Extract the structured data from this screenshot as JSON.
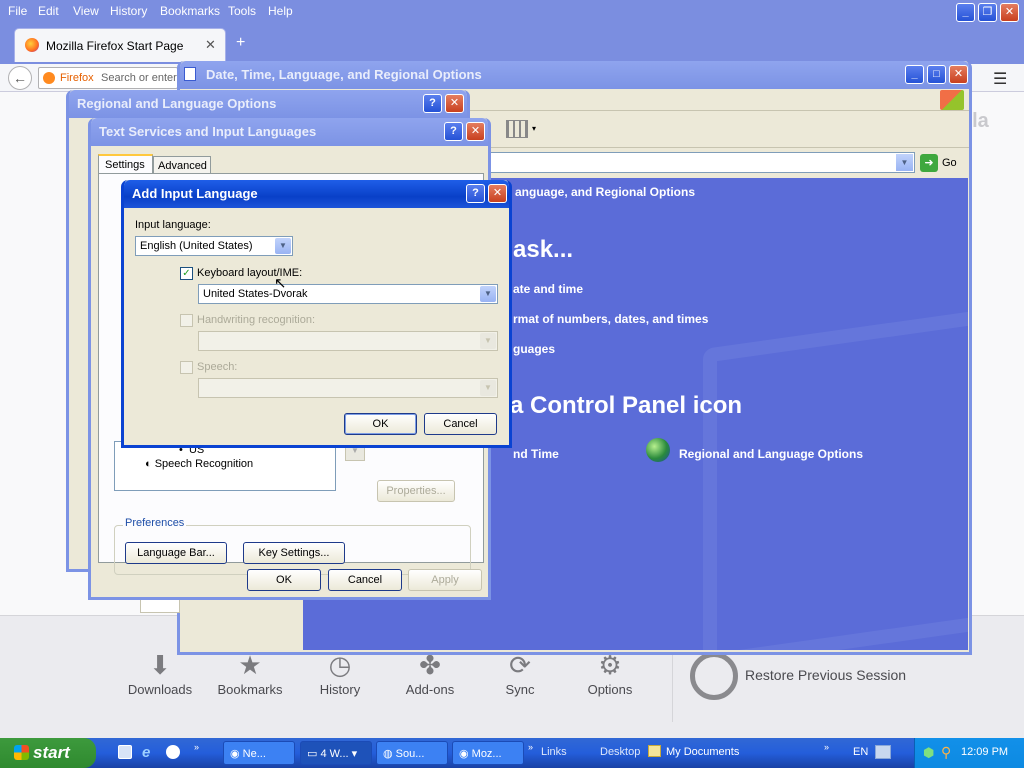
{
  "firefox": {
    "menu": [
      "File",
      "Edit",
      "View",
      "History",
      "Bookmarks",
      "Tools",
      "Help"
    ],
    "tab_title": "Mozilla Firefox Start Page",
    "identity_label": "Firefox",
    "url_placeholder": "Search or enter",
    "launchers": [
      {
        "label": "Downloads",
        "icon": "download-icon"
      },
      {
        "label": "Bookmarks",
        "icon": "star-icon"
      },
      {
        "label": "History",
        "icon": "clock-icon"
      },
      {
        "label": "Add-ons",
        "icon": "puzzle-icon"
      },
      {
        "label": "Sync",
        "icon": "sync-icon"
      },
      {
        "label": "Options",
        "icon": "gear-icon"
      }
    ],
    "restore_session": "Restore Previous Session",
    "brand_partial": "zilla"
  },
  "control_panel": {
    "title": "Date, Time, Language, and Regional Options",
    "go_label": "Go",
    "header_partial": "anguage, and Regional Options",
    "pick_task_partial": "ask...",
    "tasks_partial": [
      "ate and time",
      "rmat of numbers, dates, and times",
      "guages"
    ],
    "pick_icon_partial": "a Control Panel icon",
    "icon_item_partial": "nd Time",
    "icon_item_regional": "Regional and Language Options"
  },
  "regional_dialog": {
    "title": "Regional and Language Options"
  },
  "text_services": {
    "title": "Text Services and Input Languages",
    "tabs": [
      "Settings",
      "Advanced"
    ],
    "list_item_us": "US",
    "list_item_speech_partial": "Speech Recognition",
    "properties_button": "Properties...",
    "preferences_label": "Preferences",
    "language_bar_button": "Language Bar...",
    "key_settings_button": "Key Settings...",
    "ok": "OK",
    "cancel": "Cancel",
    "apply": "Apply"
  },
  "add_input_language": {
    "title": "Add Input Language",
    "input_language_label": "Input language:",
    "input_language_value": "English (United States)",
    "keyboard_label": "Keyboard layout/IME:",
    "keyboard_value": "United States-Dvorak",
    "handwriting_label": "Handwriting recognition:",
    "speech_label": "Speech:",
    "ok": "OK",
    "cancel": "Cancel"
  },
  "taskbar": {
    "start": "start",
    "tasks": [
      "Ne...",
      "4 W...",
      "Sou...",
      "Moz..."
    ],
    "links": "Links",
    "desktop": "Desktop",
    "my_documents": "My Documents",
    "language": "EN",
    "clock": "12:09 PM"
  }
}
